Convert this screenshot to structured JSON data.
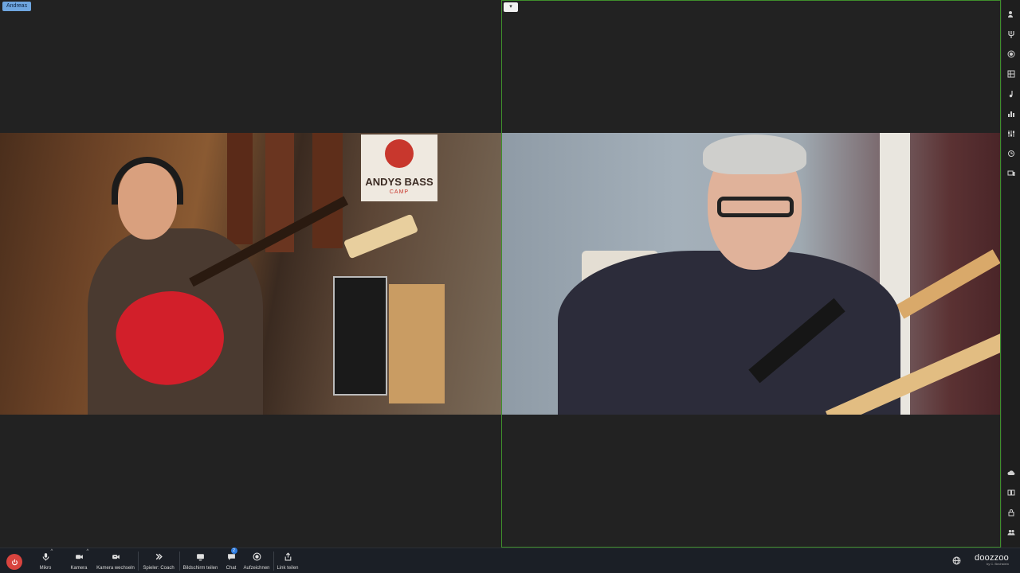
{
  "participants": [
    {
      "name": "Andreas"
    },
    {
      "name": ""
    }
  ],
  "tile_dropdown_icon": "chevron-down-icon",
  "video_scene": {
    "sign_line1": "ANDYS BASS",
    "sign_line2": "CAMP"
  },
  "sidebar": {
    "items": [
      "participant-edit-icon",
      "tuner-icon",
      "record-dot-icon",
      "sheet-music-icon",
      "music-note-icon",
      "level-meter-icon",
      "mixer-icon",
      "history-icon",
      "devices-icon"
    ],
    "bottom_items": [
      "cloud-icon",
      "layout-icon",
      "lock-icon",
      "participants-icon"
    ]
  },
  "toolbar": {
    "mic_label": "Mikro",
    "camera_label": "Kamera",
    "switch_camera_label": "Kamera wechseln",
    "player_label": "Spieler: Coach",
    "screen_share_label": "Bildschirm teilen",
    "chat_label": "Chat",
    "chat_badge": "2",
    "record_label": "Aufzeichnen",
    "share_link_label": "Link teilen"
  },
  "brand": {
    "name": "doozzoo",
    "tagline": "by C. Bechstein"
  },
  "colors": {
    "end_call": "#d8443f",
    "active_border": "#3f8f2c",
    "name_label": "#6fa6e0",
    "badge": "#2f7de1"
  }
}
